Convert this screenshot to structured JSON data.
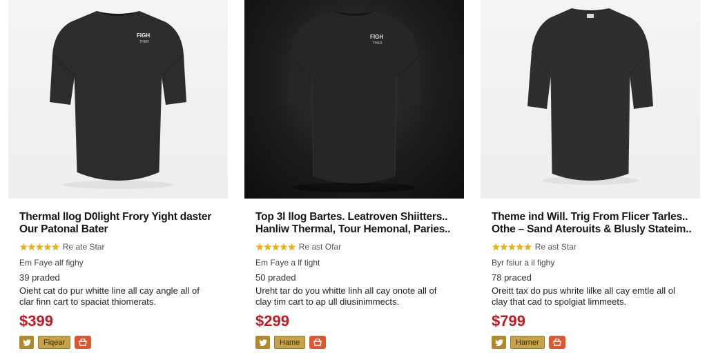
{
  "products": [
    {
      "title_line1": "Thermal llog D0light Frory Yight daster",
      "title_line2": "Our Patonal Bater",
      "stars": "★★★★★",
      "rating_text": "Re ate Star",
      "meta1": "Em Faye alf fighy",
      "meta2": "39 praded",
      "desc_line1": "Oieht cat do pur whitte line all cay angle all of",
      "desc_line2": "clar finn cart to spaciat thiomerats.",
      "price": "$399",
      "action_label": "Fiqear",
      "photo_style": "light",
      "logo": "front"
    },
    {
      "title_line1": "Top 3l llog Bartes. Leatroven Shiitters..",
      "title_line2": "Hanliw Thermal, Tour Hemonal, Paries..",
      "stars": "★★★★★",
      "rating_text": "Re ast Ofar",
      "meta1": "Em Faye a lf tight",
      "meta2": "50 praded",
      "desc_line1": "Ureht tar do you whitte linh all cay onote all of",
      "desc_line2": "clay tim cart to ap ull diusinimmects.",
      "price": "$299",
      "action_label": "Hame",
      "photo_style": "dark",
      "logo": "front"
    },
    {
      "title_line1": "Theme ind Will. Trig From Flicer Tarles..",
      "title_line2": "Othe – Sand Aterouits & Blusly Stateim..",
      "stars": "★★★★★",
      "rating_text": "Re ast Star",
      "meta1": "Byr fsiur a il fighy",
      "meta2": "78 praced",
      "desc_line1": "Oreitt tax do pus whrite lilke all cay emtle all ol",
      "desc_line2": "clay that cad to spolgiat limmeets.",
      "price": "$799",
      "action_label": "Harner",
      "photo_style": "light",
      "logo": "back"
    }
  ],
  "colors": {
    "price": "#c8171e",
    "star": "#f0b400",
    "share_button": "#b08a2a",
    "label_button": "#c8a24a",
    "cart_button": "#e0552c",
    "shirt": "#2b2b2b"
  },
  "icons": {
    "share": "twitter-icon",
    "cart": "cart-icon"
  }
}
